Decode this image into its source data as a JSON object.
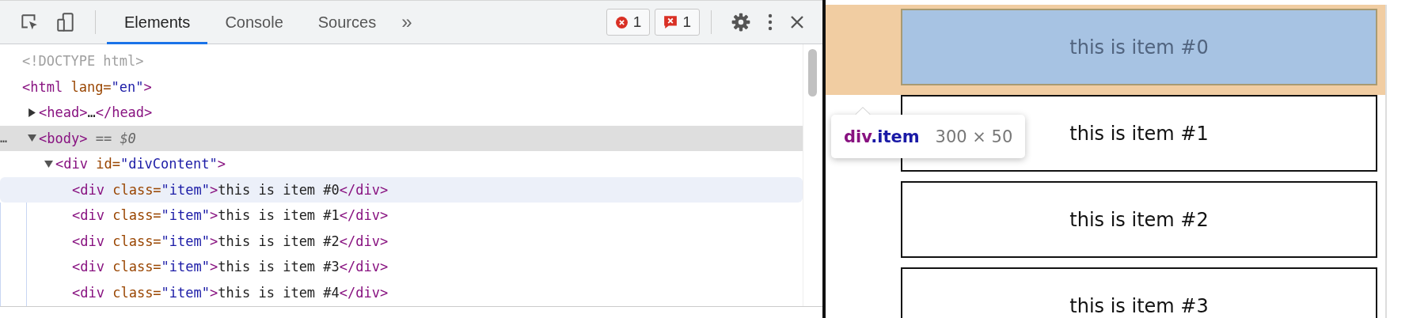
{
  "toolbar": {
    "tabs": [
      {
        "label": "Elements",
        "selected": true
      },
      {
        "label": "Console",
        "selected": false
      },
      {
        "label": "Sources",
        "selected": false
      }
    ],
    "more": "»",
    "badges": [
      {
        "kind": "error",
        "count": "1"
      },
      {
        "kind": "issue",
        "count": "1"
      }
    ]
  },
  "tree": [
    {
      "parts": [
        {
          "kind": "doctype",
          "text": "<!DOCTYPE html>"
        }
      ],
      "selected": false,
      "hovered": false
    },
    {
      "parts": [
        {
          "kind": "tag",
          "text": "<html"
        },
        {
          "kind": "attr",
          "text": " lang="
        },
        {
          "kind": "value",
          "text": "\"en\""
        },
        {
          "kind": "tag",
          "text": ">"
        }
      ],
      "selected": false,
      "hovered": false,
      "children": [
        {
          "parts": [
            {
              "kind": "tag",
              "text": "<head>"
            },
            {
              "kind": "text",
              "text": "…"
            },
            {
              "kind": "tag",
              "text": "</head>"
            }
          ],
          "expanded": false,
          "selected": false,
          "hovered": false
        },
        {
          "gutter": "…",
          "parts": [
            {
              "kind": "tag",
              "text": "<body>"
            },
            {
              "kind": "note",
              "text": " == "
            },
            {
              "kind": "var",
              "text": "$0"
            }
          ],
          "expanded": true,
          "selected": true,
          "hovered": false,
          "children": [
            {
              "parts": [
                {
                  "kind": "tag",
                  "text": "<div"
                },
                {
                  "kind": "attr",
                  "text": " id="
                },
                {
                  "kind": "value",
                  "text": "\"divContent\""
                },
                {
                  "kind": "tag",
                  "text": ">"
                }
              ],
              "expanded": true,
              "selected": false,
              "hovered": false,
              "children": [
                {
                  "parts": [
                    {
                      "kind": "tag",
                      "text": "<div"
                    },
                    {
                      "kind": "attr",
                      "text": " class="
                    },
                    {
                      "kind": "value",
                      "text": "\"item\""
                    },
                    {
                      "kind": "tag",
                      "text": ">"
                    },
                    {
                      "kind": "text",
                      "text": "this is item #0"
                    },
                    {
                      "kind": "tag",
                      "text": "</div>"
                    }
                  ],
                  "selected": false,
                  "hovered": true
                },
                {
                  "parts": [
                    {
                      "kind": "tag",
                      "text": "<div"
                    },
                    {
                      "kind": "attr",
                      "text": " class="
                    },
                    {
                      "kind": "value",
                      "text": "\"item\""
                    },
                    {
                      "kind": "tag",
                      "text": ">"
                    },
                    {
                      "kind": "text",
                      "text": "this is item #1"
                    },
                    {
                      "kind": "tag",
                      "text": "</div>"
                    }
                  ],
                  "selected": false,
                  "hovered": false
                },
                {
                  "parts": [
                    {
                      "kind": "tag",
                      "text": "<div"
                    },
                    {
                      "kind": "attr",
                      "text": " class="
                    },
                    {
                      "kind": "value",
                      "text": "\"item\""
                    },
                    {
                      "kind": "tag",
                      "text": ">"
                    },
                    {
                      "kind": "text",
                      "text": "this is item #2"
                    },
                    {
                      "kind": "tag",
                      "text": "</div>"
                    }
                  ],
                  "selected": false,
                  "hovered": false
                },
                {
                  "parts": [
                    {
                      "kind": "tag",
                      "text": "<div"
                    },
                    {
                      "kind": "attr",
                      "text": " class="
                    },
                    {
                      "kind": "value",
                      "text": "\"item\""
                    },
                    {
                      "kind": "tag",
                      "text": ">"
                    },
                    {
                      "kind": "text",
                      "text": "this is item #3"
                    },
                    {
                      "kind": "tag",
                      "text": "</div>"
                    }
                  ],
                  "selected": false,
                  "hovered": false
                },
                {
                  "parts": [
                    {
                      "kind": "tag",
                      "text": "<div"
                    },
                    {
                      "kind": "attr",
                      "text": " class="
                    },
                    {
                      "kind": "value",
                      "text": "\"item\""
                    },
                    {
                      "kind": "tag",
                      "text": ">"
                    },
                    {
                      "kind": "text",
                      "text": "this is item #4"
                    },
                    {
                      "kind": "tag",
                      "text": "</div>"
                    }
                  ],
                  "selected": false,
                  "hovered": false
                }
              ]
            }
          ]
        }
      ]
    }
  ],
  "viewport": {
    "items": [
      {
        "label": "this is item #0",
        "highlighted": true
      },
      {
        "label": "this is item #1",
        "highlighted": false
      },
      {
        "label": "this is item #2",
        "highlighted": false
      },
      {
        "label": "this is item #3",
        "highlighted": false
      }
    ],
    "tooltip": {
      "tag": "div",
      "class_name": ".item",
      "size": "300 × 50"
    }
  }
}
